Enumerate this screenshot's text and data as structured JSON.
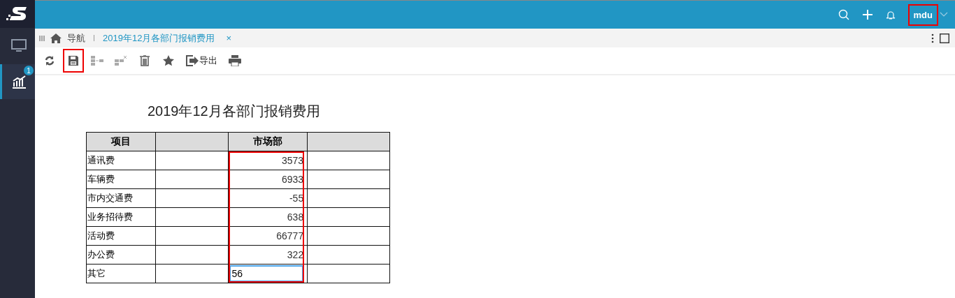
{
  "header": {
    "user": "mdu",
    "user_highlighted": true
  },
  "sidebar": {
    "items": [
      {
        "selected": false
      },
      {
        "selected": true,
        "badge": "1"
      }
    ]
  },
  "tabs": {
    "home": "导航",
    "items": [
      {
        "label": "2019年12月各部门报销费用",
        "selected": true,
        "close": "×"
      }
    ]
  },
  "toolbar": {
    "buttons": [
      {
        "kind": "refresh",
        "disabled": false,
        "highlighted": false
      },
      {
        "kind": "save",
        "disabled": false,
        "highlighted": true
      },
      {
        "kind": "insert",
        "disabled": true,
        "highlighted": false
      },
      {
        "kind": "remove",
        "disabled": true,
        "highlighted": false
      },
      {
        "kind": "delete",
        "disabled": false,
        "highlighted": false
      },
      {
        "kind": "star",
        "disabled": false,
        "highlighted": false
      },
      {
        "kind": "export",
        "disabled": false,
        "highlighted": false,
        "label": "导出"
      },
      {
        "kind": "print",
        "disabled": false,
        "highlighted": false
      }
    ]
  },
  "report": {
    "title": "2019年12月各部门报销费用",
    "columns": [
      "项目",
      "",
      "市场部",
      ""
    ],
    "value_column_highlighted": true,
    "rows": [
      {
        "item": "通讯费",
        "value": "3573",
        "kind": "text"
      },
      {
        "item": "车辆费",
        "value": "6933",
        "kind": "text"
      },
      {
        "item": "市内交通费",
        "value": "-55",
        "kind": "text"
      },
      {
        "item": "业务招待费",
        "value": "638",
        "kind": "text"
      },
      {
        "item": "活动费",
        "value": "66777",
        "kind": "text"
      },
      {
        "item": "办公费",
        "value": "322",
        "kind": "text"
      },
      {
        "item": "其它",
        "value": "56",
        "kind": "input"
      }
    ]
  }
}
